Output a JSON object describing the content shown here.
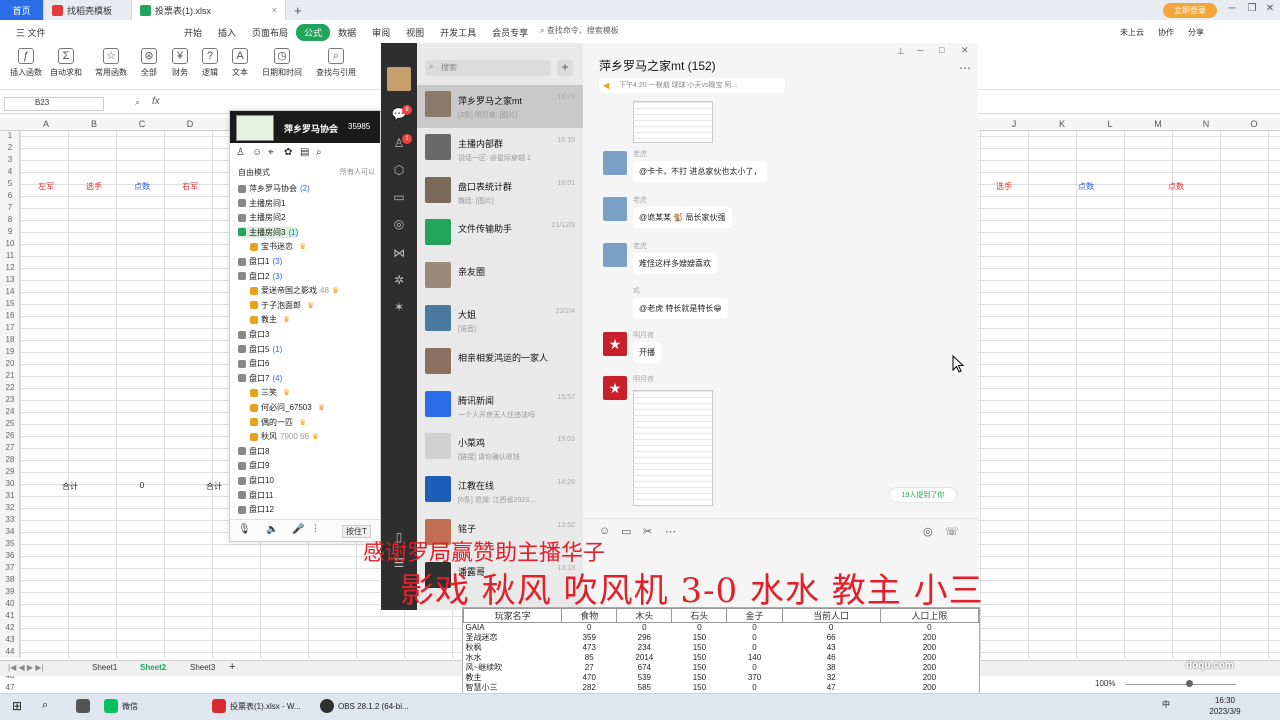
{
  "tabs": [
    "首页",
    "找稻壳模板",
    "投票表(1).xlsx"
  ],
  "login_label": "立即登录",
  "menu": [
    "三 文件",
    "开始",
    "插入",
    "页面布局",
    "公式",
    "数据",
    "审阅",
    "视图",
    "开发工具",
    "会员专享"
  ],
  "menu_active": "公式",
  "search_cmd": "查找命令、搜索模板",
  "top_right": [
    "未上云",
    "协作",
    "分享"
  ],
  "ribbon": [
    "插入函数",
    "自动求和",
    "常用函数",
    "全部",
    "财务",
    "逻辑",
    "文本",
    "日期和时间",
    "查找与引用"
  ],
  "name_box": "B23",
  "fx": "fx",
  "columns": [
    "A",
    "B",
    "C",
    "D",
    "J",
    "K",
    "L",
    "M",
    "N",
    "O",
    "P",
    "Q",
    "R",
    "S"
  ],
  "rows": [
    "1",
    "2",
    "3",
    "4",
    "5",
    "6",
    "7",
    "8",
    "9",
    "10",
    "11",
    "12",
    "13",
    "14",
    "15",
    "16",
    "17",
    "18",
    "19",
    "20",
    "21",
    "22",
    "23",
    "24",
    "25",
    "26",
    "27",
    "28",
    "29",
    "30",
    "31",
    "32",
    "33",
    "34",
    "35",
    "36",
    "37",
    "38",
    "39",
    "40",
    "41",
    "42",
    "43",
    "44",
    "45",
    "46",
    "47",
    "48"
  ],
  "cells": {
    "r5": [
      "左军",
      "选手",
      "点数",
      "右军"
    ],
    "r5_right": [
      "选手",
      "点数",
      "点数"
    ],
    "r30": [
      "合计",
      "0",
      "合计"
    ]
  },
  "sheets": [
    "Sheet1",
    "Sheet2",
    "Sheet3"
  ],
  "active_sheet": "Sheet2",
  "zoom": "100%",
  "group_panel": {
    "title": "萍乡罗马协会",
    "id": "35985",
    "view": "自由模式",
    "filter": "所有人可以",
    "items": [
      {
        "label": "萍乡罗马协会",
        "count": "(2)",
        "indent": 0,
        "kind": "group"
      },
      {
        "label": "主播房间1",
        "count": "",
        "indent": 0,
        "kind": "room"
      },
      {
        "label": "主播房间2",
        "count": "",
        "indent": 0,
        "kind": "room"
      },
      {
        "label": "主播房间3",
        "count": "(1)",
        "indent": 0,
        "kind": "room-sel"
      },
      {
        "label": "宝书迷恋",
        "count": "",
        "indent": 1,
        "kind": "user"
      },
      {
        "label": "盘口1",
        "count": "(3)",
        "indent": 0,
        "kind": "room"
      },
      {
        "label": "盘口2",
        "count": "(3)",
        "indent": 0,
        "kind": "room"
      },
      {
        "label": "爱迷帝国之影戏",
        "count": "48",
        "indent": 1,
        "kind": "user"
      },
      {
        "label": "于子泡面郎",
        "count": "",
        "indent": 1,
        "kind": "user"
      },
      {
        "label": "教主",
        "count": "",
        "indent": 1,
        "kind": "user"
      },
      {
        "label": "盘口3",
        "count": "",
        "indent": 0,
        "kind": "room"
      },
      {
        "label": "盘口5",
        "count": "(1)",
        "indent": 0,
        "kind": "room"
      },
      {
        "label": "盘口6",
        "count": "",
        "indent": 0,
        "kind": "room"
      },
      {
        "label": "盘口7",
        "count": "(4)",
        "indent": 0,
        "kind": "room"
      },
      {
        "label": "三笑",
        "count": "",
        "indent": 1,
        "kind": "user"
      },
      {
        "label": "何必问_67503",
        "count": "",
        "indent": 1,
        "kind": "user"
      },
      {
        "label": "偶的一匹",
        "count": "",
        "indent": 1,
        "kind": "user"
      },
      {
        "label": "秋风",
        "count": "7900 66",
        "indent": 1,
        "kind": "user"
      },
      {
        "label": "盘口8",
        "count": "",
        "indent": 0,
        "kind": "room"
      },
      {
        "label": "盘口9",
        "count": "",
        "indent": 0,
        "kind": "room"
      },
      {
        "label": "盘口10",
        "count": "",
        "indent": 0,
        "kind": "room"
      },
      {
        "label": "盘口11",
        "count": "",
        "indent": 0,
        "kind": "room"
      },
      {
        "label": "盘口12",
        "count": "",
        "indent": 0,
        "kind": "room"
      }
    ],
    "footer_btn": "按住T"
  },
  "wechat": {
    "search": "搜索",
    "nav_badges": [
      "8",
      "1"
    ],
    "chats": [
      {
        "name": "萍乡罗马之家mt",
        "time": "16:29",
        "msg": "[2条] 明月夜: [图片]",
        "color": "#8a7a6a",
        "sel": true
      },
      {
        "name": "主播内部群",
        "time": "16:15",
        "msg": "锐话一区: @星际穿越 1",
        "color": "#6a6a6a"
      },
      {
        "name": "盘口表统计群",
        "time": "16:01",
        "msg": "魏廷: [图片]",
        "color": "#7a6a5a"
      },
      {
        "name": "文件传输助手",
        "time": "21/12/3",
        "msg": "",
        "color": "#22a45d"
      },
      {
        "name": "亲友圈",
        "time": "",
        "msg": "",
        "color": "#9a8a7a"
      },
      {
        "name": "大姐",
        "time": "23/2/4",
        "msg": "[语音]",
        "color": "#4a7aa0"
      },
      {
        "name": "相亲相爱鸿运的一家人",
        "time": "",
        "msg": "",
        "color": "#8a7060"
      },
      {
        "name": "腾讯新闻",
        "time": "15:57",
        "msg": "一个人开房无人住违法吗",
        "color": "#2b6de8"
      },
      {
        "name": "小菜鸡",
        "time": "15:03",
        "msg": "[链接] 请你确认收钱",
        "color": "#d0d0d0"
      },
      {
        "name": "江教在线",
        "time": "14:28",
        "msg": "[6条] 退湖: 江西省2023...",
        "color": "#1d5fb8"
      },
      {
        "name": "铭子",
        "time": "13:52",
        "msg": "",
        "color": "#c07050"
      },
      {
        "name": "潘露哥",
        "time": "13:13",
        "msg": "",
        "color": "#303030"
      }
    ],
    "chat_title": "萍乡罗马之家mt (152)",
    "notice": "下午4:20 一根烟 球球 小天vs概宝 阿...",
    "messages": [
      {
        "name": "老虎",
        "text": "@卡卡，不打 进总家伙也太小了，",
        "color": "#7aa0c8"
      },
      {
        "name": "老虎",
        "text": "@诡某某 🐒 局长家伙强",
        "color": "#7aa0c8"
      },
      {
        "name": "老虎",
        "text": "难怪这样多嫂嫂喜欢",
        "color": "#7aa0c8"
      },
      {
        "name": "鸡",
        "text": "@老虎 特长就是特长😁",
        "color": "#f5f5f5"
      },
      {
        "name": "明月夜",
        "text": "开播",
        "color": "#c8202a"
      },
      {
        "name": "明月夜",
        "text": "",
        "color": "#c8202a"
      }
    ],
    "mention": "19人提到了你"
  },
  "overlay": {
    "line1": "感谢罗局赢赞助主播华子",
    "line2": "影戏 秋风 吹风机 3-0 水水 教主 小三"
  },
  "score_table": {
    "headers": [
      "玩家名字",
      "食物",
      "木头",
      "石头",
      "金子",
      "当前人口",
      "人口上限"
    ],
    "rows": [
      [
        "GAIA",
        "0",
        "0",
        "0",
        "0",
        "0",
        "0"
      ],
      [
        "圣战迷恋",
        "359",
        "296",
        "150",
        "0",
        "66",
        "200"
      ],
      [
        "秋枫",
        "473",
        "234",
        "150",
        "0",
        "43",
        "200"
      ],
      [
        "水水",
        "85",
        "2014",
        "150",
        "140",
        "46",
        "200"
      ],
      [
        "风~继续吹",
        "27",
        "674",
        "150",
        "0",
        "38",
        "200"
      ],
      [
        "教主",
        "470",
        "539",
        "150",
        "370",
        "32",
        "200"
      ],
      [
        "智慧小三",
        "282",
        "585",
        "150",
        "0",
        "47",
        "200"
      ]
    ]
  },
  "watermark": "doqu.com",
  "taskbar": [
    "微信",
    "投票表(1).xlsx - W...",
    "OBS 28.1.2 (64-bi..."
  ],
  "clock": {
    "time": "16:30",
    "date": "2023/3/9"
  },
  "ime": "中"
}
